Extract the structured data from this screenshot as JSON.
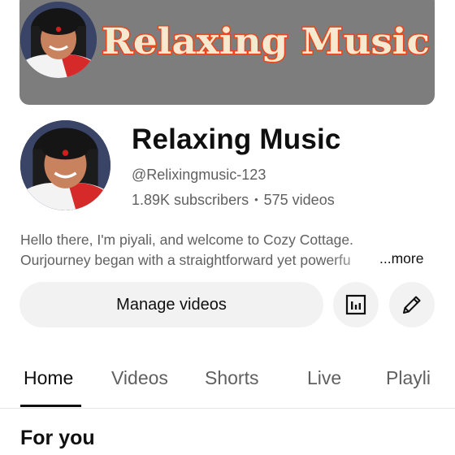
{
  "banner": {
    "title": "Relaxing Music",
    "background_color": "#7d7d7d",
    "title_fill": "#f5ead0",
    "title_stroke": "#e8461c"
  },
  "channel": {
    "name": "Relaxing Music",
    "handle": "@Relixingmusic-123",
    "subscribers": "1.89K subscribers",
    "separator": "•",
    "videos": "575 videos",
    "description_line1": "Hello there, I'm piyali, and welcome to Cozy Cottage.",
    "description_line2": "Ourjourney began with a straightforward yet powerfu",
    "more_label": "...more"
  },
  "actions": {
    "manage_videos_label": "Manage videos",
    "analytics_icon": "analytics-icon",
    "edit_icon": "pencil-icon"
  },
  "tabs": [
    {
      "label": "Home",
      "active": true
    },
    {
      "label": "Videos",
      "active": false
    },
    {
      "label": "Shorts",
      "active": false
    },
    {
      "label": "Live",
      "active": false
    },
    {
      "label": "Playli",
      "active": false
    }
  ],
  "section": {
    "title": "For you"
  }
}
